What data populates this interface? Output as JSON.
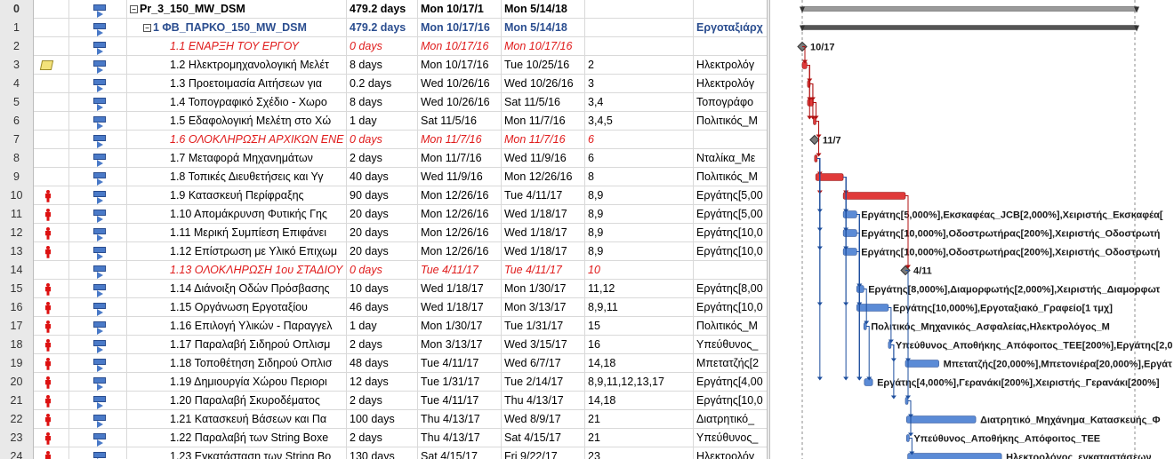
{
  "rows": [
    {
      "id": "0",
      "type": "sum0",
      "ind": "",
      "res_icon": false,
      "name": "Pr_3_150_MW_DSM",
      "duration": "479.2 days",
      "start": "Mon 10/17/1",
      "finish": "Mon 5/14/18",
      "pred": "",
      "resources": ""
    },
    {
      "id": "1",
      "type": "sum1",
      "ind": "",
      "res_icon": false,
      "name": "1 ΦΒ_ΠΑΡΚΟ_150_MW_DSM",
      "duration": "479.2 days",
      "start": "Mon 10/17/16",
      "finish": "Mon 5/14/18",
      "pred": "",
      "resources": "Εργοταξιάρχ"
    },
    {
      "id": "2",
      "type": "mile",
      "ind": "",
      "res_icon": false,
      "name": "1.1 ΕΝΑΡΞΗ ΤΟΥ ΕΡΓΟΥ",
      "duration": "0 days",
      "start": "Mon 10/17/16",
      "finish": "Mon 10/17/16",
      "pred": "",
      "resources": ""
    },
    {
      "id": "3",
      "type": "task",
      "ind": "note",
      "res_icon": false,
      "name": "1.2 Ηλεκτρομηχανολογική Μελέτ",
      "duration": "8 days",
      "start": "Mon 10/17/16",
      "finish": "Tue 10/25/16",
      "pred": "2",
      "resources": "Ηλεκτρολόγ"
    },
    {
      "id": "4",
      "type": "task",
      "ind": "",
      "res_icon": false,
      "name": "1.3 Προετοιμασία Αιτήσεων για",
      "duration": "0.2 days",
      "start": "Wed 10/26/16",
      "finish": "Wed 10/26/16",
      "pred": "3",
      "resources": "Ηλεκτρολόγ"
    },
    {
      "id": "5",
      "type": "task",
      "ind": "",
      "res_icon": false,
      "name": "1.4 Τοπογραφικό Σχέδιο - Χωρο",
      "duration": "8 days",
      "start": "Wed 10/26/16",
      "finish": "Sat 11/5/16",
      "pred": "3,4",
      "resources": "Τοπογράφο"
    },
    {
      "id": "6",
      "type": "task",
      "ind": "",
      "res_icon": false,
      "name": "1.5 Εδαφολογική Μελέτη στο Χώ",
      "duration": "1 day",
      "start": "Sat 11/5/16",
      "finish": "Mon 11/7/16",
      "pred": "3,4,5",
      "resources": "Πολιτικός_Μ"
    },
    {
      "id": "7",
      "type": "mile",
      "ind": "",
      "res_icon": false,
      "name": "1.6 ΟΛΟΚΛΗΡΩΣΗ ΑΡΧΙΚΩΝ ΕΝΕ",
      "duration": "0 days",
      "start": "Mon 11/7/16",
      "finish": "Mon 11/7/16",
      "pred": "6",
      "resources": ""
    },
    {
      "id": "8",
      "type": "task",
      "ind": "",
      "res_icon": false,
      "name": "1.7 Μεταφορά Μηχανημάτων",
      "duration": "2 days",
      "start": "Mon 11/7/16",
      "finish": "Wed 11/9/16",
      "pred": "6",
      "resources": "Νταλίκα_Με"
    },
    {
      "id": "9",
      "type": "task",
      "ind": "",
      "res_icon": false,
      "name": "1.8 Τοπικές Διευθετήσεις και Υγ",
      "duration": "40 days",
      "start": "Wed 11/9/16",
      "finish": "Mon 12/26/16",
      "pred": "8",
      "resources": "Πολιτικός_Μ"
    },
    {
      "id": "10",
      "type": "task",
      "ind": "",
      "res_icon": true,
      "name": "1.9 Κατασκευή Περίφραξης",
      "duration": "90 days",
      "start": "Mon 12/26/16",
      "finish": "Tue 4/11/17",
      "pred": "8,9",
      "resources": "Εργάτης[5,00"
    },
    {
      "id": "11",
      "type": "task",
      "ind": "",
      "res_icon": true,
      "name": "1.10 Απομάκρυνση Φυτικής Γης",
      "duration": "20 days",
      "start": "Mon 12/26/16",
      "finish": "Wed 1/18/17",
      "pred": "8,9",
      "resources": "Εργάτης[5,00"
    },
    {
      "id": "12",
      "type": "task",
      "ind": "",
      "res_icon": true,
      "name": "1.11 Μερική Συμπίεση Επιφάνει",
      "duration": "20 days",
      "start": "Mon 12/26/16",
      "finish": "Wed 1/18/17",
      "pred": "8,9",
      "resources": "Εργάτης[10,0"
    },
    {
      "id": "13",
      "type": "task",
      "ind": "",
      "res_icon": true,
      "name": "1.12 Επίστρωση με Υλικό Επιχωμ",
      "duration": "20 days",
      "start": "Mon 12/26/16",
      "finish": "Wed 1/18/17",
      "pred": "8,9",
      "resources": "Εργάτης[10,0"
    },
    {
      "id": "14",
      "type": "mile",
      "ind": "",
      "res_icon": false,
      "name": "1.13 ΟΛΟΚΛΗΡΩΣΗ 1ου ΣΤΑΔΙΟΥ",
      "duration": "0 days",
      "start": "Tue 4/11/17",
      "finish": "Tue 4/11/17",
      "pred": "10",
      "resources": ""
    },
    {
      "id": "15",
      "type": "task",
      "ind": "",
      "res_icon": true,
      "name": "1.14 Διάνοιξη Οδών Πρόσβασης",
      "duration": "10 days",
      "start": "Wed 1/18/17",
      "finish": "Mon 1/30/17",
      "pred": "11,12",
      "resources": "Εργάτης[8,00"
    },
    {
      "id": "16",
      "type": "task",
      "ind": "",
      "res_icon": true,
      "name": "1.15 Οργάνωση Εργοταξίου",
      "duration": "46 days",
      "start": "Wed 1/18/17",
      "finish": "Mon 3/13/17",
      "pred": "8,9,11",
      "resources": "Εργάτης[10,0"
    },
    {
      "id": "17",
      "type": "task",
      "ind": "",
      "res_icon": true,
      "name": "1.16 Επιλογή Υλικών - Παραγγελ",
      "duration": "1 day",
      "start": "Mon 1/30/17",
      "finish": "Tue 1/31/17",
      "pred": "15",
      "resources": "Πολιτικός_Μ"
    },
    {
      "id": "18",
      "type": "task",
      "ind": "",
      "res_icon": true,
      "name": "1.17 Παραλαβή Σιδηρού Οπλισμ",
      "duration": "2 days",
      "start": "Mon 3/13/17",
      "finish": "Wed 3/15/17",
      "pred": "16",
      "resources": "Υπεύθυνος_"
    },
    {
      "id": "19",
      "type": "task",
      "ind": "",
      "res_icon": true,
      "name": "1.18 Τοποθέτηση Σιδηρού Οπλισ",
      "duration": "48 days",
      "start": "Tue 4/11/17",
      "finish": "Wed 6/7/17",
      "pred": "14,18",
      "resources": "Μπετατζής[2"
    },
    {
      "id": "20",
      "type": "task",
      "ind": "",
      "res_icon": true,
      "name": "1.19 Δημιουργία Χώρου Περιορι",
      "duration": "12 days",
      "start": "Tue 1/31/17",
      "finish": "Tue 2/14/17",
      "pred": "8,9,11,12,13,17",
      "resources": "Εργάτης[4,00"
    },
    {
      "id": "21",
      "type": "task",
      "ind": "",
      "res_icon": true,
      "name": "1.20 Παραλαβή Σκυροδέματος",
      "duration": "2 days",
      "start": "Tue 4/11/17",
      "finish": "Thu 4/13/17",
      "pred": "14,18",
      "resources": "Εργάτης[10,0"
    },
    {
      "id": "22",
      "type": "task",
      "ind": "",
      "res_icon": true,
      "name": "1.21 Κατασκευή Βάσεων και Πα",
      "duration": "100 days",
      "start": "Thu 4/13/17",
      "finish": "Wed 8/9/17",
      "pred": "21",
      "resources": "Διατρητικό_"
    },
    {
      "id": "23",
      "type": "task",
      "ind": "",
      "res_icon": true,
      "name": "1.22 Παραλαβή των String Boxe",
      "duration": "2 days",
      "start": "Thu 4/13/17",
      "finish": "Sat 4/15/17",
      "pred": "21",
      "resources": "Υπεύθυνος_"
    },
    {
      "id": "24",
      "type": "task",
      "ind": "",
      "res_icon": true,
      "name": "1.23 Εγκατάσταση των String Bo",
      "duration": "130 days",
      "start": "Sat 4/15/17",
      "finish": "Fri 9/22/17",
      "pred": "23",
      "resources": "Ηλεκτρολόγ"
    }
  ],
  "gantt": {
    "milestone_labels": {
      "2": "10/17",
      "7": "11/7",
      "14": "4/11"
    },
    "bar_labels": {
      "11": "Εργάτης[5,000%],Εκσκαφέας_JCB[2,000%],Χειριστής_Εκσκαφέα[",
      "12": "Εργάτης[10,000%],Οδοστρωτήρας[200%],Χειριστής_Οδοστρωτή",
      "13": "Εργάτης[10,000%],Οδοστρωτήρας[200%],Χειριστής_Οδοστρωτή",
      "15": "Εργάτης[8,000%],Διαμορφωτής[2,000%],Χειριστής_Διαμορφωτ",
      "16": "Εργάτης[10,000%],Εργοταξιακό_Γραφείο[1 τμχ]",
      "17": "Πολιτικός_Μηχανικός_Ασφαλείας,Ηλεκτρολόγος_Μ",
      "18": "Υπεύθυνος_Αποθήκης_Απόφοιτος_ΤΕΕ[200%],Εργάτης[2,0",
      "19": "Μπετατζής[20,000%],Μπετονιέρα[20,000%],Εργάτ",
      "20": "Εργάτης[4,000%],Γερανάκι[200%],Χειριστής_Γερανάκι[200%]",
      "22": "Διατρητικό_Μηχάνημα_Κατασκευής_Φ",
      "23": "Υπεύθυνος_Αποθήκης_Απόφοιτος_ΤΕΕ",
      "24": "Ηλεκτρολόγος_εγκαταστάσεων"
    },
    "colors": {
      "critical": "#e03a3a",
      "normal": "#5b8bd6",
      "summary": "#7a7a7a",
      "milestone": "#7a7a7a",
      "link_red": "#b01010",
      "link_blue": "#1e4f9e"
    }
  }
}
